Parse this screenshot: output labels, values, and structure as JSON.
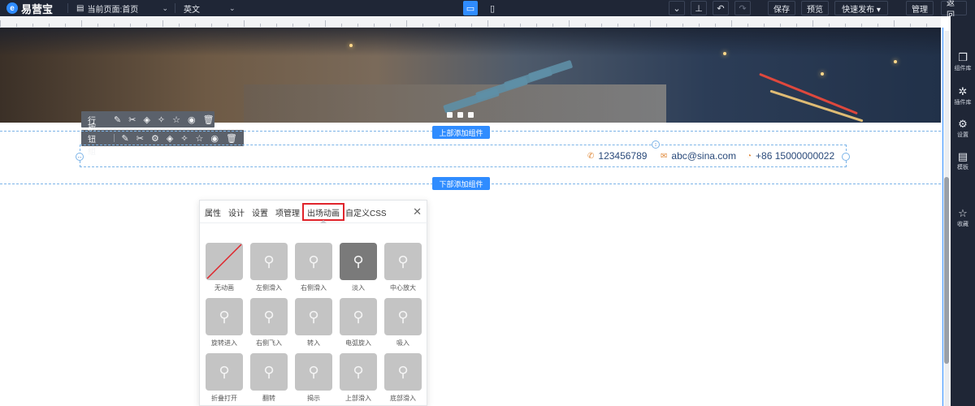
{
  "topbar": {
    "logo_text": "易营宝",
    "page_select": "当前页面:首页",
    "language_select": "英文",
    "device_desktop_icon": "desktop-icon",
    "device_mobile_icon": "mobile-icon",
    "tools": [
      "collapse-icon",
      "align-bottom-icon",
      "undo-icon",
      "redo-icon"
    ],
    "save_label": "保存",
    "preview_label": "预览",
    "quick_publish_label": "快速发布 ▾",
    "manage_label": "管理",
    "back_label": "返回"
  },
  "rightrail": {
    "items": [
      {
        "icon": "component-library-icon",
        "label": "组件库"
      },
      {
        "icon": "plugin-library-icon",
        "label": "插件库"
      },
      {
        "icon": "settings-icon",
        "label": "设置"
      },
      {
        "icon": "template-icon",
        "label": "模板"
      },
      {
        "icon": "favorites-icon",
        "label": "收藏"
      }
    ]
  },
  "canvas": {
    "row_toolbar_label": "行",
    "button_group_toolbar_label": "按钮组",
    "add_top_label": "上部添加组件",
    "add_bottom_label": "下部添加组件",
    "contacts": {
      "phone": "123456789",
      "email": "abc@sina.com",
      "whatsapp": "+86 15000000022"
    }
  },
  "panel": {
    "tabs": [
      "属性",
      "设计",
      "设置",
      "项管理",
      "出场动画",
      "自定义CSS"
    ],
    "active_tab": "出场动画",
    "animations": [
      "无动画",
      "左侧滑入",
      "右侧滑入",
      "淡入",
      "中心放大",
      "旋转进入",
      "右侧飞入",
      "转入",
      "电弧旋入",
      "吸入",
      "折叠打开",
      "翻转",
      "揭示",
      "上部滑入",
      "底部滑入"
    ],
    "selected_animation": "淡入"
  },
  "colors": {
    "topbar_bg": "#1f2636",
    "accent_blue": "#2f8cff",
    "highlight_red": "#e0242b",
    "thumb_gray": "#c4c4c4",
    "thumb_selected": "#7a7a7a"
  }
}
